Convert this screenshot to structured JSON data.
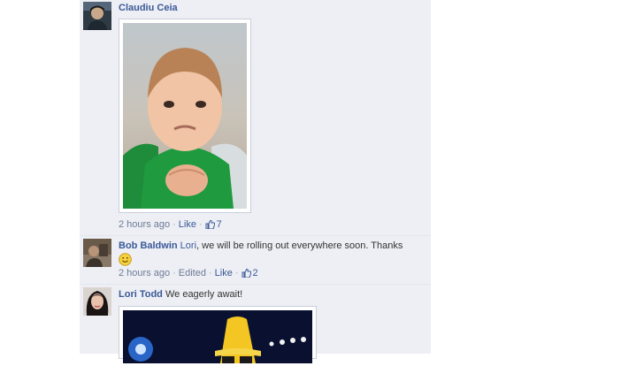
{
  "comments": [
    {
      "author": "Claudiu Ceia",
      "timestamp": "2 hours ago",
      "like_action": "Like",
      "like_count": "7",
      "photo": "baby-fist-pump-photo"
    },
    {
      "author": "Bob Baldwin",
      "mention": "Lori",
      "text": ", we will be rolling out everywhere soon. Thanks",
      "emoticon": "smiley-icon",
      "timestamp": "2 hours ago",
      "edited_label": "Edited",
      "like_action": "Like",
      "like_count": "2"
    },
    {
      "author": "Lori Todd",
      "text": "We eagerly await!",
      "photo": "yellow-hat-sunglasses-photo"
    }
  ],
  "colors": {
    "link": "#3b5998",
    "meta": "#6d7a96",
    "thread_bg": "#edeff4",
    "divider": "#e3e6ee"
  }
}
